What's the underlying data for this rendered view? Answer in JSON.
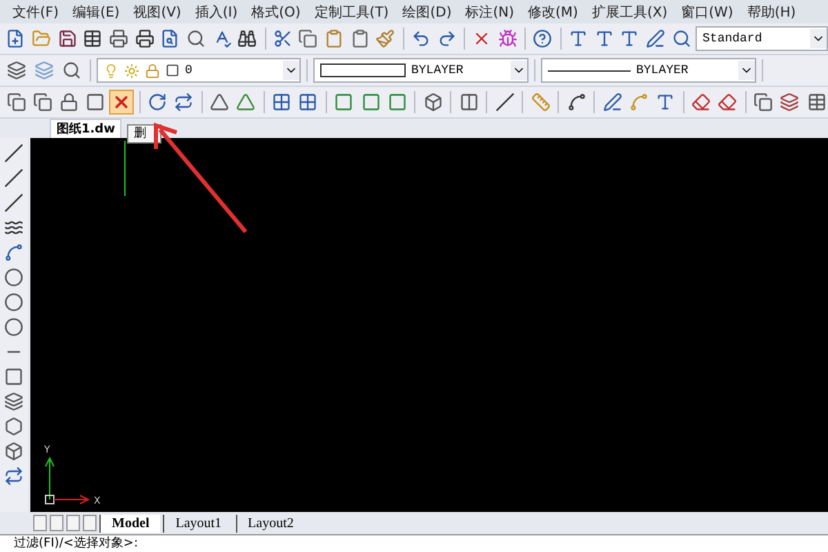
{
  "menu_bar": [
    {
      "label": "文件(F)"
    },
    {
      "label": "编辑(E)"
    },
    {
      "label": "视图(V)"
    },
    {
      "label": "插入(I)"
    },
    {
      "label": "格式(O)"
    },
    {
      "label": "定制工具(T)"
    },
    {
      "label": "绘图(D)"
    },
    {
      "label": "标注(N)"
    },
    {
      "label": "修改(M)"
    },
    {
      "label": "扩展工具(X)"
    },
    {
      "label": "窗口(W)"
    },
    {
      "label": "帮助(H)"
    }
  ],
  "text_style_combo": {
    "value": "Standard"
  },
  "layer_combo": {
    "value": "0"
  },
  "color_combo": {
    "value": "BYLAYER"
  },
  "linetype_combo": {
    "value": "BYLAYER"
  },
  "document_tab": {
    "label": "图纸1.dw"
  },
  "tooltip": {
    "text": "删"
  },
  "axis_labels": {
    "y": "Y",
    "x": "X"
  },
  "layout_tabs": [
    {
      "label": "Model",
      "selected": true
    },
    {
      "label": "Layout1",
      "selected": false
    },
    {
      "label": "Layout2",
      "selected": false
    }
  ],
  "command_line": {
    "text": "过滤(FI)/<选择对象>:"
  }
}
